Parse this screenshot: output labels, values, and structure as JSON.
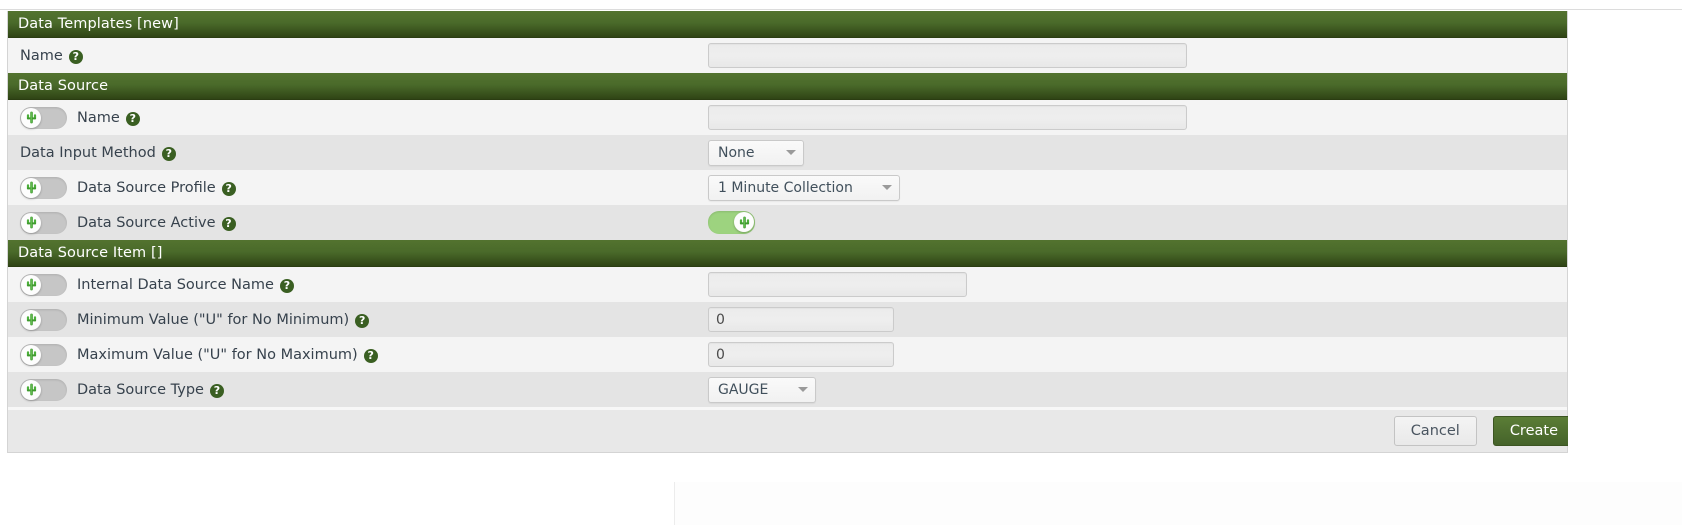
{
  "window": {
    "title": "Data Templates [new]"
  },
  "sections": {
    "data_templates": {
      "header": "Data Templates [new]",
      "name_label": "Name",
      "name_value": "",
      "name_placeholder": ""
    },
    "data_source": {
      "header": "Data Source",
      "rows": {
        "name": {
          "label": "Name",
          "value": "",
          "toggle_state": "off"
        },
        "data_input_method": {
          "label": "Data Input Method",
          "selected": "None",
          "options": [
            "None"
          ]
        },
        "data_source_profile": {
          "label": "Data Source Profile",
          "selected": "1 Minute Collection",
          "options": [
            "1 Minute Collection"
          ],
          "toggle_state": "off"
        },
        "data_source_active": {
          "label": "Data Source Active",
          "toggle_state": "on",
          "value_toggle_state": "on"
        }
      }
    },
    "data_source_item": {
      "header": "Data Source Item []",
      "rows": {
        "internal_name": {
          "label": "Internal Data Source Name",
          "value": "",
          "toggle_state": "off"
        },
        "minimum_value": {
          "label": "Minimum Value (\"U\" for No Minimum)",
          "value": "0",
          "toggle_state": "off"
        },
        "maximum_value": {
          "label": "Maximum Value (\"U\" for No Maximum)",
          "value": "0",
          "toggle_state": "off"
        },
        "data_source_type": {
          "label": "Data Source Type",
          "selected": "GAUGE",
          "options": [
            "GAUGE"
          ],
          "toggle_state": "off"
        }
      }
    }
  },
  "footer": {
    "cancel_label": "Cancel",
    "create_label": "Create"
  },
  "icons": {
    "help": "?",
    "toggle_knob": "cactus-icon",
    "dropdown_caret": "chevron-down-icon"
  },
  "colors": {
    "header_green_top": "#53732f",
    "header_green_bottom": "#2f4415",
    "toggle_on": "#9dd37f",
    "toggle_off": "#c6c6c6",
    "create_button": "#4f7030",
    "row_odd": "#f4f4f4",
    "row_even": "#e4e4e4",
    "help_icon": "#3a5f22"
  }
}
